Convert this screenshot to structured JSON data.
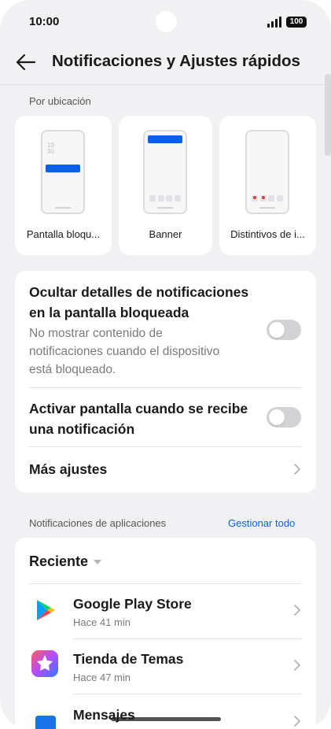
{
  "status": {
    "time": "10:00",
    "battery": "100"
  },
  "header": {
    "title": "Notificaciones y Ajustes rápidos"
  },
  "styles_section": {
    "label": "Por ubicación",
    "tiles": [
      {
        "label": "Pantalla bloqu..."
      },
      {
        "label": "Banner"
      },
      {
        "label": "Distintivos de i..."
      }
    ],
    "clock_text": "19\n30"
  },
  "settings": {
    "hide_details": {
      "title_line1": "Ocultar detalles de notificaciones",
      "title_line2": "en la pantalla bloqueada",
      "sub_line1": "No mostrar contenido de",
      "sub_line2": "notificaciones cuando el dispositivo",
      "sub_line3": "está bloqueado.",
      "enabled": false
    },
    "wake_screen": {
      "title_line1": "Activar pantalla cuando se recibe",
      "title_line2": "una notificación",
      "enabled": false
    },
    "more": {
      "title": "Más ajustes"
    }
  },
  "apps_section": {
    "label": "Notificaciones de aplicaciones",
    "manage_link": "Gestionar todo",
    "sort_label": "Reciente",
    "apps": [
      {
        "name": "Google Play Store",
        "time": "Hace 41 min",
        "icon": "google-play-icon"
      },
      {
        "name": "Tienda de Temas",
        "time": "Hace 47 min",
        "icon": "theme-store-icon"
      },
      {
        "name": "Mensajes",
        "time": "",
        "icon": "messages-icon"
      }
    ]
  },
  "colors": {
    "accent": "#0a62e8",
    "background": "#f1f1f3",
    "card": "#ffffff"
  }
}
